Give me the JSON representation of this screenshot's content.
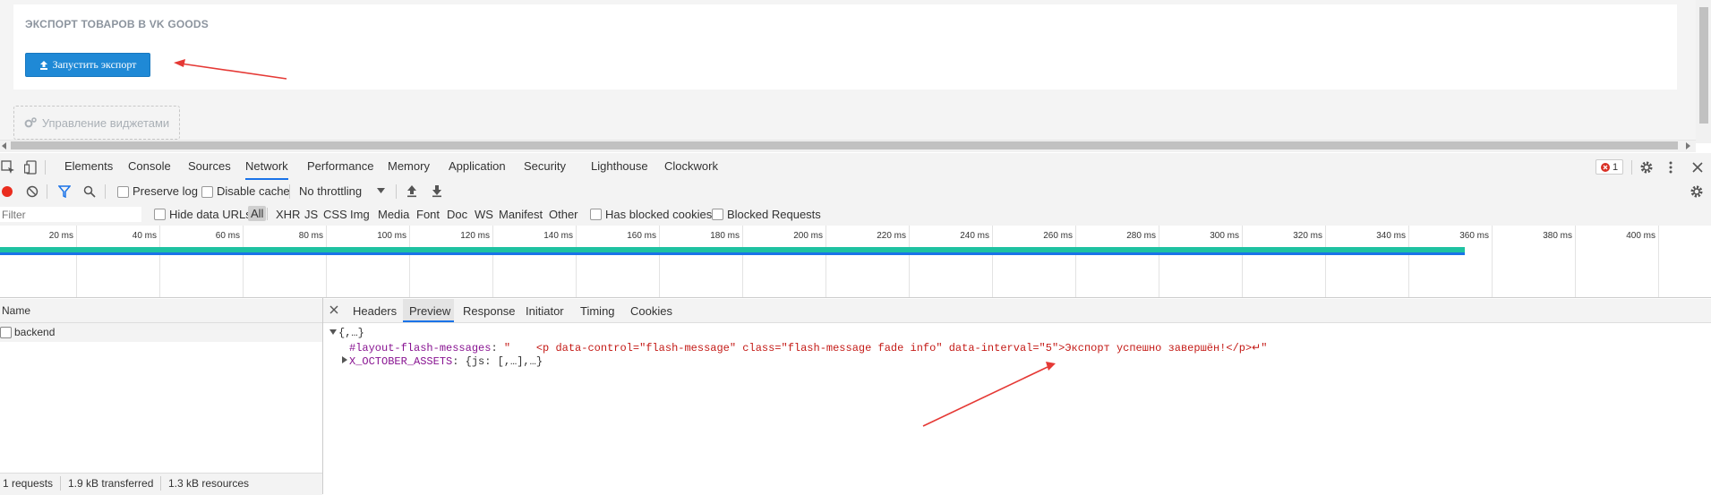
{
  "page": {
    "panel_title": "ЭКСПОРТ ТОВАРОВ В VK GOODS",
    "export_button": "Запустить экспорт",
    "widgets_button": "Управление виджетами"
  },
  "devtools": {
    "tabs": [
      "Elements",
      "Console",
      "Sources",
      "Network",
      "Performance",
      "Memory",
      "Application",
      "Security",
      "Lighthouse",
      "Clockwork"
    ],
    "active_tab": "Network",
    "error_count": "1",
    "toolbar": {
      "preserve_log": "Preserve log",
      "disable_cache": "Disable cache",
      "throttling": "No throttling"
    },
    "filter": {
      "placeholder": "Filter",
      "hide_data_urls": "Hide data URLs",
      "types": [
        "All",
        "XHR",
        "JS",
        "CSS",
        "Img",
        "Media",
        "Font",
        "Doc",
        "WS",
        "Manifest",
        "Other"
      ],
      "has_blocked_cookies": "Has blocked cookies",
      "blocked_requests": "Blocked Requests"
    },
    "timeline_ticks": [
      "20 ms",
      "40 ms",
      "60 ms",
      "80 ms",
      "100 ms",
      "120 ms",
      "140 ms",
      "160 ms",
      "180 ms",
      "200 ms",
      "220 ms",
      "240 ms",
      "260 ms",
      "280 ms",
      "300 ms",
      "320 ms",
      "340 ms",
      "360 ms",
      "380 ms",
      "400 ms"
    ],
    "request_list": {
      "column_name": "Name",
      "rows": [
        "backend"
      ]
    },
    "status": {
      "requests": "1 requests",
      "transferred": "1.9 kB transferred",
      "resources": "1.3 kB resources"
    },
    "detail_tabs": [
      "Headers",
      "Preview",
      "Response",
      "Initiator",
      "Timing",
      "Cookies"
    ],
    "active_detail_tab": "Preview",
    "preview": {
      "root": "{,…}",
      "key1": "#layout-flash-messages",
      "value1": "\"    <p data-control=\"flash-message\" class=\"flash-message fade info\" data-interval=\"5\">Экспорт успешно завершён!</p>↵\"",
      "key2": "X_OCTOBER_ASSETS",
      "value2": "{js: [,…],…}"
    }
  },
  "colors": {
    "accent": "#1f89d6",
    "devtools_blue": "#1a73e8",
    "waterfall": "#1ec2a1",
    "json_key": "#881391",
    "json_string": "#c41a16",
    "arrow": "#e53935"
  }
}
